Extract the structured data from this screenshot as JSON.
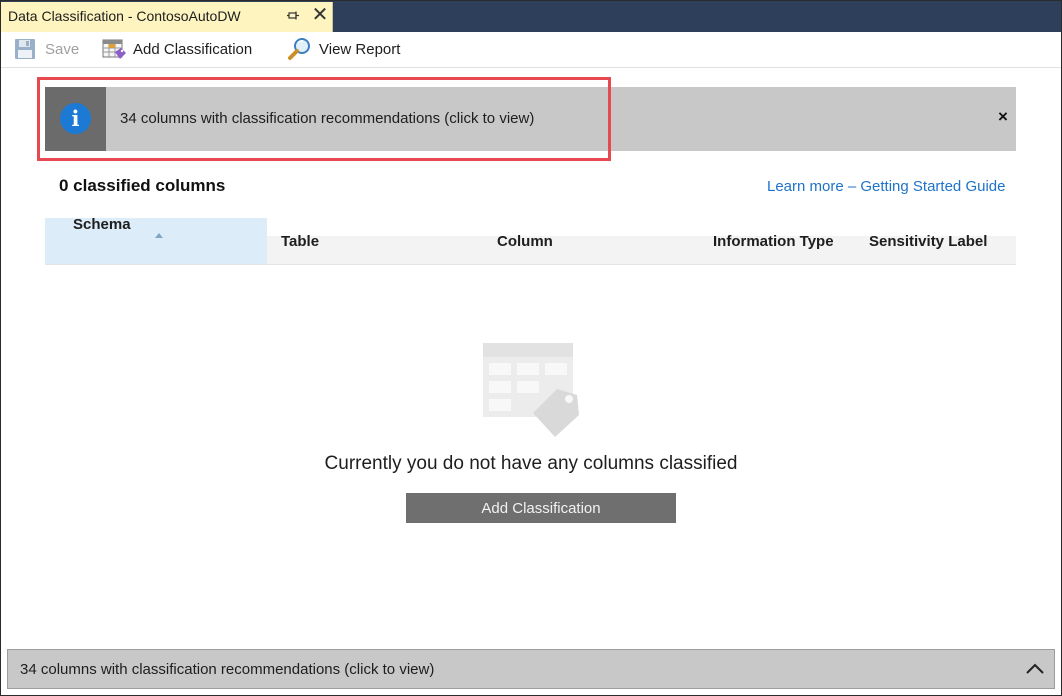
{
  "tab": {
    "title": "Data Classification - ContosoAutoDW",
    "pin_glyph": "⊣",
    "close_glyph": "✕"
  },
  "toolbar": {
    "save_label": "Save",
    "save_icon": "floppy-disk-icon",
    "add_label": "Add Classification",
    "add_icon": "table-tag-icon",
    "report_label": "View Report",
    "report_icon": "magnifier-icon"
  },
  "info_bar": {
    "message": "34 columns with classification recommendations (click to view)",
    "icon_glyph": "i",
    "close_glyph": "×",
    "highlight_color": "#e8484f"
  },
  "summary": {
    "classified_count": "0 classified columns",
    "learn_more": "Learn more – Getting Started Guide"
  },
  "grid": {
    "columns": [
      "Schema",
      "Table",
      "Column",
      "Information Type",
      "Sensitivity Label"
    ],
    "sorted_column": "Schema"
  },
  "empty_state": {
    "message": "Currently you do not have any columns classified",
    "button_label": "Add Classification",
    "icon": "table-tag-placeholder-icon"
  },
  "bottom_bar": {
    "message": "34 columns with classification recommendations (click to view)",
    "chevron": "chevron-up-icon"
  },
  "colors": {
    "tab_strip": "#2d3f5a",
    "tab_active": "#fdf4bf",
    "info_accent": "#1d7ad4",
    "link": "#1e73c8",
    "selected_header": "#dcecf8"
  }
}
